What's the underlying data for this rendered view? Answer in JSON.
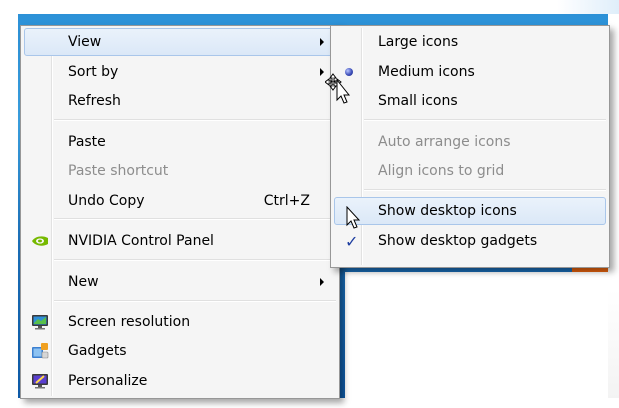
{
  "context_menu": {
    "items": [
      {
        "label": "View",
        "submenu": true
      },
      {
        "label": "Sort by",
        "submenu": true
      },
      {
        "label": "Refresh"
      },
      {
        "label": "Paste"
      },
      {
        "label": "Paste shortcut",
        "disabled": true
      },
      {
        "label": "Undo Copy",
        "shortcut": "Ctrl+Z"
      },
      {
        "label": "NVIDIA Control Panel",
        "icon": "nvidia-icon"
      },
      {
        "label": "New",
        "submenu": true
      },
      {
        "label": "Screen resolution",
        "icon": "screen-resolution-icon"
      },
      {
        "label": "Gadgets",
        "icon": "gadgets-icon"
      },
      {
        "label": "Personalize",
        "icon": "personalize-icon"
      }
    ]
  },
  "view_submenu": {
    "items": [
      {
        "label": "Large icons"
      },
      {
        "label": "Medium icons",
        "selected": true,
        "mark": "radio-dot"
      },
      {
        "label": "Small icons"
      },
      {
        "label": "Auto arrange icons",
        "disabled": true
      },
      {
        "label": "Align icons to grid",
        "disabled": true
      },
      {
        "label": "Show desktop icons",
        "highlighted": true
      },
      {
        "label": "Show desktop gadgets",
        "checked": true,
        "mark": "✓"
      }
    ]
  },
  "colors": {
    "menu_bg": "#f5f5f5",
    "highlight_bg": "#dbe8f7",
    "highlight_border": "#a9c6ea",
    "disabled_text": "#8d8d8d",
    "check_color": "#1e3ea0"
  }
}
